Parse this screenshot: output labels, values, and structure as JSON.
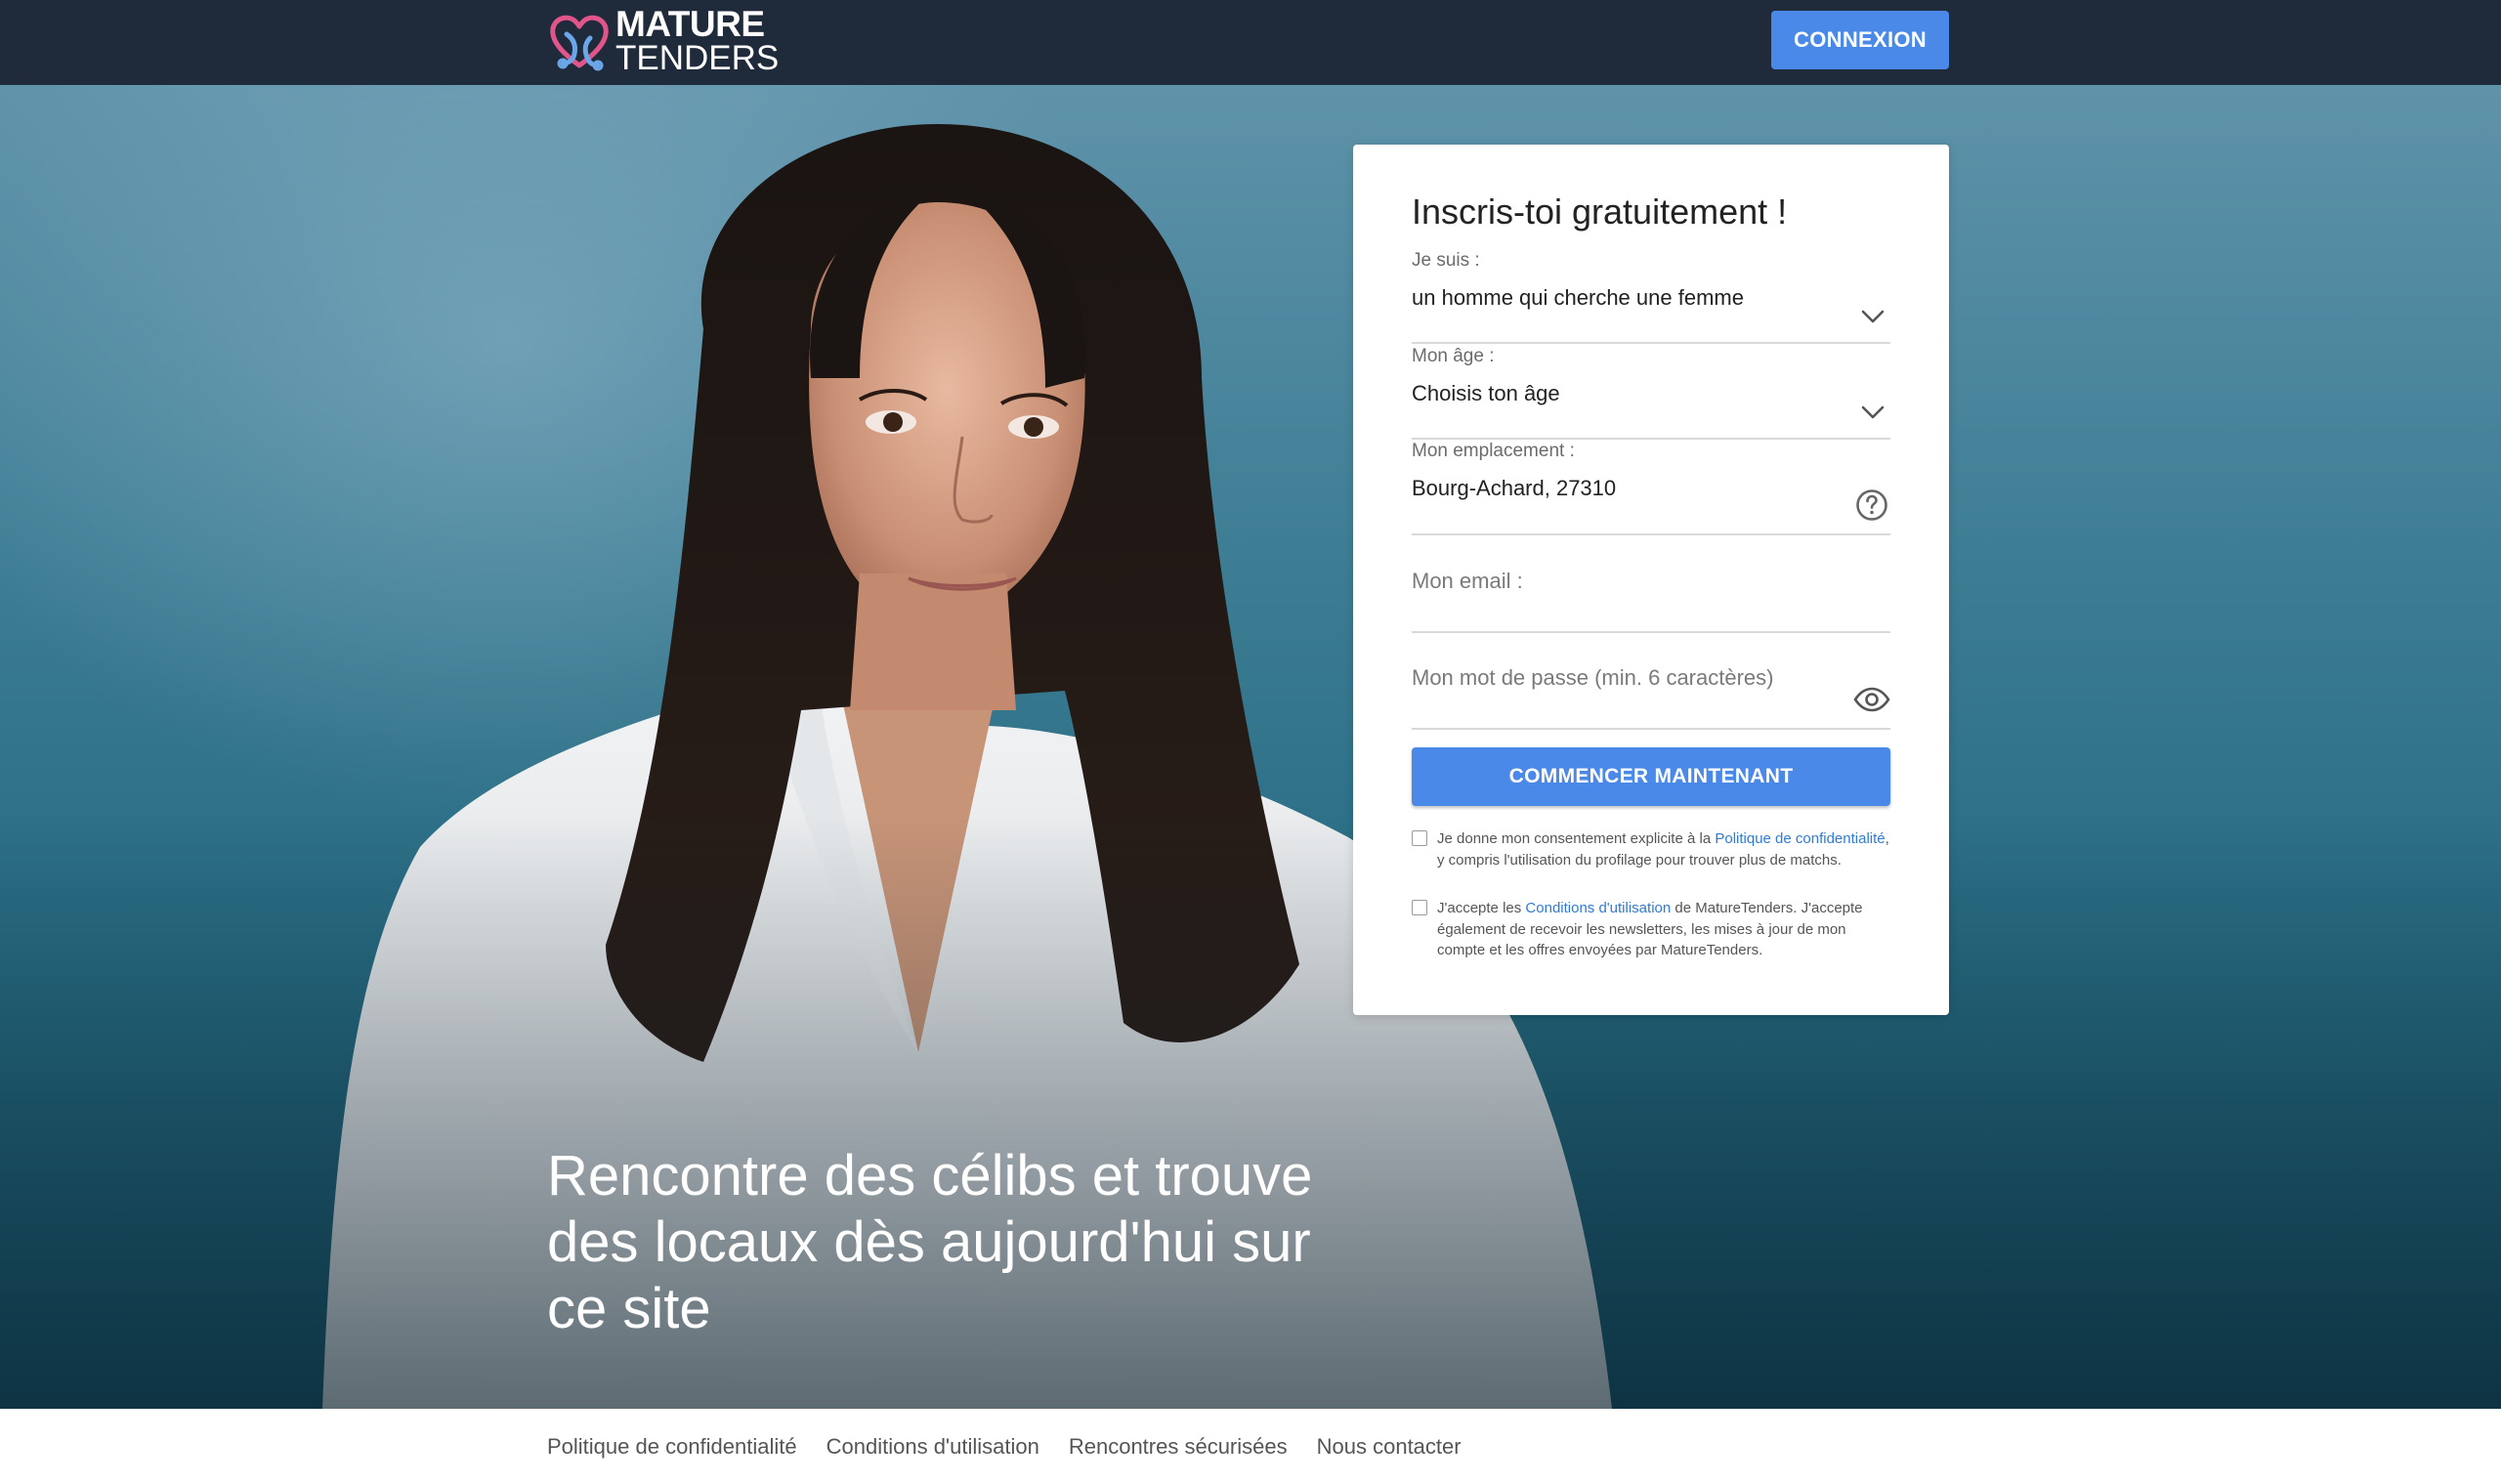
{
  "brand": {
    "line1": "MATURE",
    "line2": "TENDERS",
    "colors": {
      "heart_pink": "#e0558a",
      "heart_blue": "#6aa6e8",
      "header_bg": "#1f2a3a",
      "accent": "#4a89e8"
    }
  },
  "header": {
    "login_label": "CONNEXION"
  },
  "hero": {
    "headline": "Rencontre des célibs et trouve des locaux dès aujourd'hui sur ce site"
  },
  "form": {
    "title": "Inscris-toi gratuitement !",
    "gender": {
      "label": "Je suis :",
      "value": "un homme qui cherche une femme"
    },
    "age": {
      "label": "Mon âge :",
      "value": "Choisis ton âge"
    },
    "location": {
      "label": "Mon emplacement :",
      "value": "Bourg-Achard, 27310"
    },
    "email": {
      "placeholder": "Mon email :"
    },
    "password": {
      "placeholder": "Mon mot de passe (min. 6 caractères)"
    },
    "submit_label": "COMMENCER MAINTENANT",
    "consent1": {
      "before": "Je donne mon consentement explicite à la ",
      "link": "Politique de confidentialité",
      "after": ", y compris l'utilisation du profilage pour trouver plus de matchs."
    },
    "consent2": {
      "before": "J'accepte les ",
      "link": "Conditions d'utilisation",
      "after": " de MatureTenders. J'accepte également de recevoir les newsletters, les mises à jour de mon compte et les offres envoyées par MatureTenders."
    }
  },
  "footer": {
    "links": [
      "Politique de confidentialité",
      "Conditions d'utilisation",
      "Rencontres sécurisées",
      "Nous contacter"
    ]
  },
  "icons": {
    "select_chevron": "chevron-down-icon",
    "help": "question-circle-icon",
    "password_toggle": "eye-icon",
    "logo": "heart-logo-icon"
  }
}
